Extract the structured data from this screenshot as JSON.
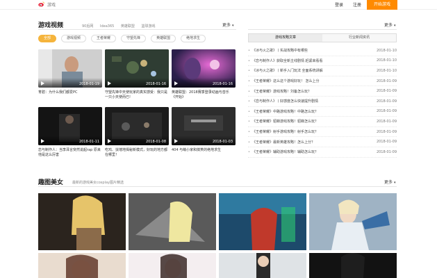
{
  "topbar": {
    "logo_text": "游戏",
    "login": "登录",
    "register": "注册",
    "cta": "开始游戏"
  },
  "videos": {
    "title": "游戏视频",
    "crumbs": [
      "90后网",
      "Idea365",
      "英雄联盟",
      "篮球游戏"
    ],
    "more": "更多",
    "filters": [
      "全部",
      "游戏视频",
      "王者荣耀",
      "守望先锋",
      "英雄联盟",
      "绝地求生"
    ],
    "items": [
      {
        "date": "2018-01-19",
        "caption": "育碧：为什么我们都爱PC"
      },
      {
        "date": "2018-01-16",
        "caption": "守望先锋中天使玩家的真实感受：我只是一只小天使而已!"
      },
      {
        "date": "2018-01-16",
        "caption": "英雄联盟：2018赛季登录动画与音乐《开始》"
      },
      {
        "date": "2018-01-11",
        "caption": "恋与制作人：当李泽言突然说起rap 原来他是这么厉害"
      },
      {
        "date": "2018-01-08",
        "caption": "吃鸡、扶墙地揭秘新模式，好玩的地方都在哪里！"
      },
      {
        "date": "2018-01-03",
        "caption": "404 与萌小家和搞笑的绝地求生"
      }
    ]
  },
  "news": {
    "tabs": [
      "游戏攻略文章",
      "行业新闻资讯"
    ],
    "more": "更多",
    "items": [
      {
        "title": "《冰与火之歌》丨实战攻略中有哪些",
        "date": "2018-01-10"
      },
      {
        "title": "《恋与制作人》获取全新主线剧情 赶紧来看看",
        "date": "2018-01-10"
      },
      {
        "title": "《冰与火之歌》丨新手入门玩法 全面系统讲解",
        "date": "2018-01-10"
      },
      {
        "title": "《王者荣耀》这么这个游戏好玩！ 怎么上分",
        "date": "2018-01-09"
      },
      {
        "title": "《王者荣耀》游戏攻略！刘备怎么玩？",
        "date": "2018-01-09"
      },
      {
        "title": "《恋与制作人》丨好感度怎么快速提升剧情",
        "date": "2018-01-09"
      },
      {
        "title": "《王者荣耀》中路游戏攻略！中路怎么玩？",
        "date": "2018-01-09"
      },
      {
        "title": "《王者荣耀》貂蝉游戏攻略！貂蝉怎么玩？",
        "date": "2018-01-09"
      },
      {
        "title": "《王者荣耀》射手游戏攻略！射手怎么玩？",
        "date": "2018-01-09"
      },
      {
        "title": "《王者荣耀》最新英雄攻略！怎么上分？",
        "date": "2018-01-09"
      },
      {
        "title": "《王者荣耀》辅助游戏攻略！辅助怎么玩？",
        "date": "2018-01-09"
      }
    ]
  },
  "gallery": {
    "title": "趣图美女",
    "desc": "最新的游戏美女cosplay图片精选",
    "more": "更多"
  },
  "colors": {
    "accent": "#ff8a00",
    "pill_active": "#f5b43c"
  }
}
